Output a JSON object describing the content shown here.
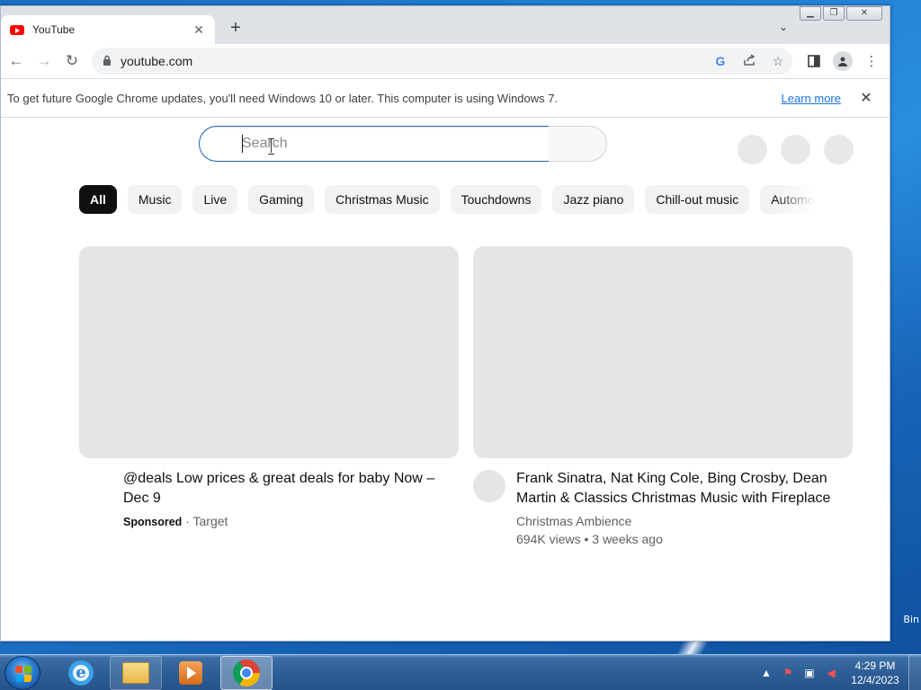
{
  "browser": {
    "tab": {
      "title": "YouTube",
      "close": "✕"
    },
    "new_tab": "+",
    "tab_search": "⌄",
    "window_controls": {
      "minimize": "▁",
      "maximize": "❐",
      "close": "✕"
    },
    "nav": {
      "back": "←",
      "forward": "→",
      "reload": "↻"
    },
    "omnibox": {
      "lock": "🔒",
      "url": "youtube.com"
    },
    "toolbar_icons": [
      "google-lens-icon",
      "share-icon",
      "bookmark-star-icon",
      "side-panel-icon",
      "profile-icon",
      "menu-icon"
    ]
  },
  "infobar": {
    "message": "To get future Google Chrome updates, you'll need Windows 10 or later. This computer is using Windows 7.",
    "link": "Learn more",
    "close": "✕"
  },
  "youtube": {
    "search": {
      "placeholder": "Search",
      "value": ""
    },
    "chips": [
      "All",
      "Music",
      "Live",
      "Gaming",
      "Christmas Music",
      "Touchdowns",
      "Jazz piano",
      "Chill-out music",
      "Automo"
    ],
    "active_chip": "All",
    "videos": [
      {
        "title": "@deals Low prices & great deals for baby Now – Dec 9",
        "sponsored_label": "Sponsored",
        "separator": "·",
        "advertiser": "Target"
      },
      {
        "title": "Frank Sinatra, Nat King Cole, Bing Crosby, Dean Martin & Classics Christmas Music with Fireplace",
        "channel": "Christmas Ambience",
        "stats": "694K views • 3 weeks ago"
      }
    ]
  },
  "desktop": {
    "recycle_label_fragment": "Bin"
  },
  "taskbar": {
    "apps": [
      "start-orb",
      "internet-explorer",
      "windows-explorer",
      "media-player",
      "google-chrome"
    ],
    "tray": {
      "expand": "▲"
    },
    "clock": {
      "time": "4:29 PM",
      "date": "12/4/2023"
    }
  },
  "colors": {
    "youtube_red": "#ff0000",
    "link_blue": "#1a73e8",
    "search_focus": "#1c62b9"
  }
}
